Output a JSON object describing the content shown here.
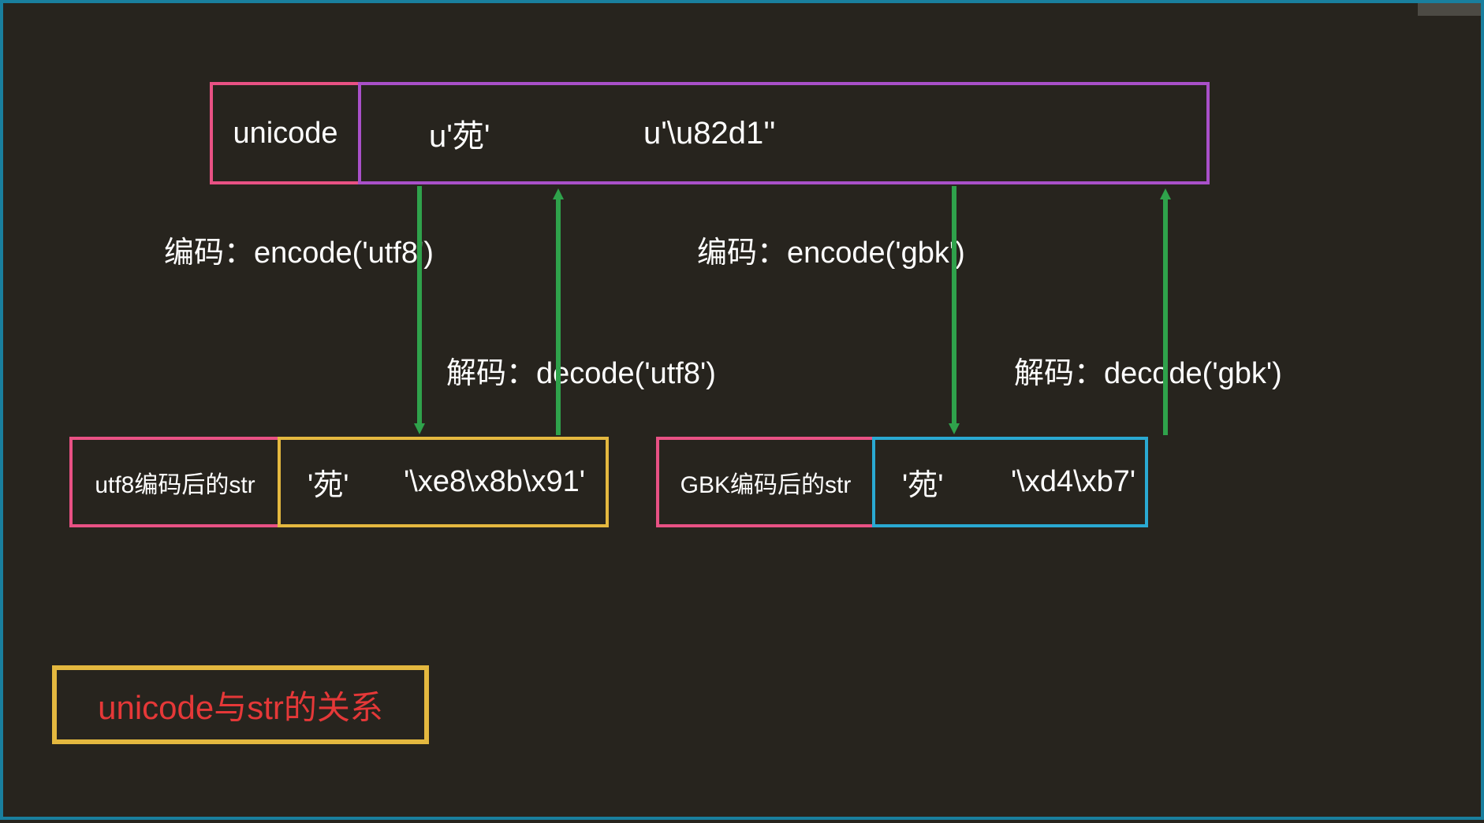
{
  "colors": {
    "bg": "#27241e",
    "frame": "#197f9e",
    "pink": "#e85184",
    "purple": "#a950c9",
    "yellow": "#e4b83f",
    "cyan": "#2aa9d2",
    "arrow": "#2fa24b",
    "title": "#e53838",
    "text": "#ffffff"
  },
  "unicode_box": {
    "label": "unicode",
    "value1": "u'苑'",
    "value2": "u'\\u82d1''"
  },
  "encode_utf8_label": "编码：encode('utf8')",
  "decode_utf8_label": "解码：decode('utf8')",
  "encode_gbk_label": "编码：encode('gbk')",
  "decode_gbk_label": "解码：decode('gbk')",
  "utf8_box": {
    "label": "utf8编码后的str",
    "value1": "'苑'",
    "value2": "'\\xe8\\x8b\\x91'"
  },
  "gbk_box": {
    "label": "GBK编码后的str",
    "value1": "'苑'",
    "value2": "'\\xd4\\xb7'"
  },
  "title": "unicode与str的关系"
}
